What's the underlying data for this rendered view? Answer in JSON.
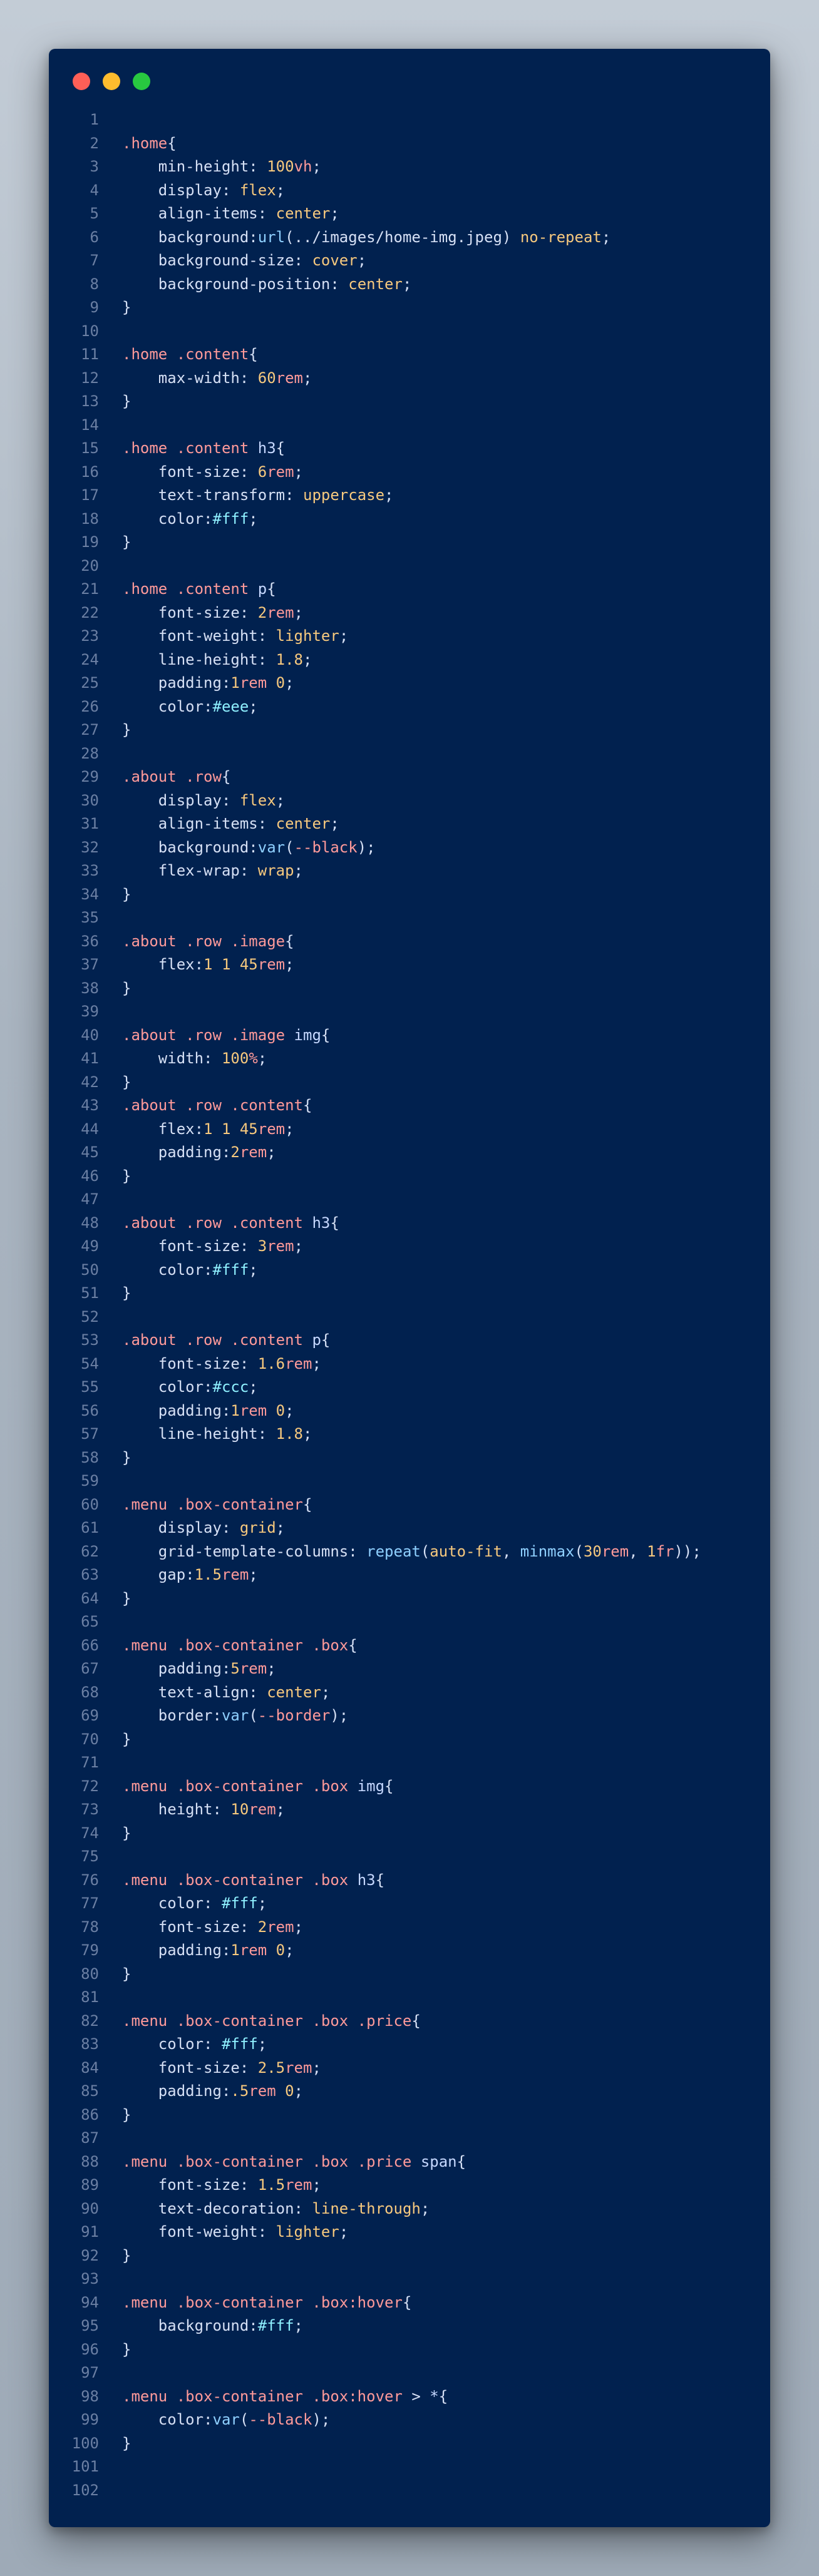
{
  "window": {
    "traffic_lights": [
      {
        "name": "close",
        "color": "#fe5f57"
      },
      {
        "name": "minimize",
        "color": "#febc2e"
      },
      {
        "name": "maximize",
        "color": "#28c840"
      }
    ]
  },
  "colors": {
    "selector": "#ff9a9a",
    "tag": "#c6d8ff",
    "property": "#d6e0f5",
    "value": "#f7c97e",
    "unit": "#ff9a9a",
    "function": "#8fd0ff",
    "hex": "#8ff0ff",
    "line_number": "#6b7fa3"
  },
  "lines": [
    [],
    [
      [
        "sel",
        ".home"
      ],
      [
        "punc",
        "{"
      ]
    ],
    [
      [
        "ind",
        "    "
      ],
      [
        "prop",
        "min-height"
      ],
      [
        "punc",
        ": "
      ],
      [
        "num",
        "100"
      ],
      [
        "unit",
        "vh"
      ],
      [
        "punc",
        ";"
      ]
    ],
    [
      [
        "ind",
        "    "
      ],
      [
        "prop",
        "display"
      ],
      [
        "punc",
        ": "
      ],
      [
        "val",
        "flex"
      ],
      [
        "punc",
        ";"
      ]
    ],
    [
      [
        "ind",
        "    "
      ],
      [
        "prop",
        "align-items"
      ],
      [
        "punc",
        ": "
      ],
      [
        "val",
        "center"
      ],
      [
        "punc",
        ";"
      ]
    ],
    [
      [
        "ind",
        "    "
      ],
      [
        "prop",
        "background"
      ],
      [
        "punc",
        ":"
      ],
      [
        "func",
        "url"
      ],
      [
        "punc",
        "("
      ],
      [
        "str",
        "../images/home-img.jpeg"
      ],
      [
        "punc",
        ") "
      ],
      [
        "val",
        "no-repeat"
      ],
      [
        "punc",
        ";"
      ]
    ],
    [
      [
        "ind",
        "    "
      ],
      [
        "prop",
        "background-size"
      ],
      [
        "punc",
        ": "
      ],
      [
        "val",
        "cover"
      ],
      [
        "punc",
        ";"
      ]
    ],
    [
      [
        "ind",
        "    "
      ],
      [
        "prop",
        "background-position"
      ],
      [
        "punc",
        ": "
      ],
      [
        "val",
        "center"
      ],
      [
        "punc",
        ";"
      ]
    ],
    [
      [
        "punc",
        "}"
      ]
    ],
    [],
    [
      [
        "sel",
        ".home .content"
      ],
      [
        "punc",
        "{"
      ]
    ],
    [
      [
        "ind",
        "    "
      ],
      [
        "prop",
        "max-width"
      ],
      [
        "punc",
        ": "
      ],
      [
        "num",
        "60"
      ],
      [
        "unit",
        "rem"
      ],
      [
        "punc",
        ";"
      ]
    ],
    [
      [
        "punc",
        "}"
      ]
    ],
    [],
    [
      [
        "sel",
        ".home .content "
      ],
      [
        "tag",
        "h3"
      ],
      [
        "punc",
        "{"
      ]
    ],
    [
      [
        "ind",
        "    "
      ],
      [
        "prop",
        "font-size"
      ],
      [
        "punc",
        ": "
      ],
      [
        "num",
        "6"
      ],
      [
        "unit",
        "rem"
      ],
      [
        "punc",
        ";"
      ]
    ],
    [
      [
        "ind",
        "    "
      ],
      [
        "prop",
        "text-transform"
      ],
      [
        "punc",
        ": "
      ],
      [
        "val",
        "uppercase"
      ],
      [
        "punc",
        ";"
      ]
    ],
    [
      [
        "ind",
        "    "
      ],
      [
        "prop",
        "color"
      ],
      [
        "punc",
        ":"
      ],
      [
        "hex",
        "#fff"
      ],
      [
        "punc",
        ";"
      ]
    ],
    [
      [
        "punc",
        "}"
      ]
    ],
    [],
    [
      [
        "sel",
        ".home .content "
      ],
      [
        "tag",
        "p"
      ],
      [
        "punc",
        "{"
      ]
    ],
    [
      [
        "ind",
        "    "
      ],
      [
        "prop",
        "font-size"
      ],
      [
        "punc",
        ": "
      ],
      [
        "num",
        "2"
      ],
      [
        "unit",
        "rem"
      ],
      [
        "punc",
        ";"
      ]
    ],
    [
      [
        "ind",
        "    "
      ],
      [
        "prop",
        "font-weight"
      ],
      [
        "punc",
        ": "
      ],
      [
        "val",
        "lighter"
      ],
      [
        "punc",
        ";"
      ]
    ],
    [
      [
        "ind",
        "    "
      ],
      [
        "prop",
        "line-height"
      ],
      [
        "punc",
        ": "
      ],
      [
        "num",
        "1.8"
      ],
      [
        "punc",
        ";"
      ]
    ],
    [
      [
        "ind",
        "    "
      ],
      [
        "prop",
        "padding"
      ],
      [
        "punc",
        ":"
      ],
      [
        "num",
        "1"
      ],
      [
        "unit",
        "rem"
      ],
      [
        "punc",
        " "
      ],
      [
        "num",
        "0"
      ],
      [
        "punc",
        ";"
      ]
    ],
    [
      [
        "ind",
        "    "
      ],
      [
        "prop",
        "color"
      ],
      [
        "punc",
        ":"
      ],
      [
        "hex",
        "#eee"
      ],
      [
        "punc",
        ";"
      ]
    ],
    [
      [
        "punc",
        "}"
      ]
    ],
    [],
    [
      [
        "sel",
        ".about .row"
      ],
      [
        "punc",
        "{"
      ]
    ],
    [
      [
        "ind",
        "    "
      ],
      [
        "prop",
        "display"
      ],
      [
        "punc",
        ": "
      ],
      [
        "val",
        "flex"
      ],
      [
        "punc",
        ";"
      ]
    ],
    [
      [
        "ind",
        "    "
      ],
      [
        "prop",
        "align-items"
      ],
      [
        "punc",
        ": "
      ],
      [
        "val",
        "center"
      ],
      [
        "punc",
        ";"
      ]
    ],
    [
      [
        "ind",
        "    "
      ],
      [
        "prop",
        "background"
      ],
      [
        "punc",
        ":"
      ],
      [
        "func",
        "var"
      ],
      [
        "punc",
        "("
      ],
      [
        "var",
        "--black"
      ],
      [
        "punc",
        ");"
      ]
    ],
    [
      [
        "ind",
        "    "
      ],
      [
        "prop",
        "flex-wrap"
      ],
      [
        "punc",
        ": "
      ],
      [
        "val",
        "wrap"
      ],
      [
        "punc",
        ";"
      ]
    ],
    [
      [
        "punc",
        "}"
      ]
    ],
    [],
    [
      [
        "sel",
        ".about .row .image"
      ],
      [
        "punc",
        "{"
      ]
    ],
    [
      [
        "ind",
        "    "
      ],
      [
        "prop",
        "flex"
      ],
      [
        "punc",
        ":"
      ],
      [
        "num",
        "1"
      ],
      [
        "punc",
        " "
      ],
      [
        "num",
        "1"
      ],
      [
        "punc",
        " "
      ],
      [
        "num",
        "45"
      ],
      [
        "unit",
        "rem"
      ],
      [
        "punc",
        ";"
      ]
    ],
    [
      [
        "punc",
        "}"
      ]
    ],
    [],
    [
      [
        "sel",
        ".about .row .image "
      ],
      [
        "tag",
        "img"
      ],
      [
        "punc",
        "{"
      ]
    ],
    [
      [
        "ind",
        "    "
      ],
      [
        "prop",
        "width"
      ],
      [
        "punc",
        ": "
      ],
      [
        "num",
        "100"
      ],
      [
        "unit",
        "%"
      ],
      [
        "punc",
        ";"
      ]
    ],
    [
      [
        "punc",
        "}"
      ]
    ],
    [
      [
        "sel",
        ".about .row .content"
      ],
      [
        "punc",
        "{"
      ]
    ],
    [
      [
        "ind",
        "    "
      ],
      [
        "prop",
        "flex"
      ],
      [
        "punc",
        ":"
      ],
      [
        "num",
        "1"
      ],
      [
        "punc",
        " "
      ],
      [
        "num",
        "1"
      ],
      [
        "punc",
        " "
      ],
      [
        "num",
        "45"
      ],
      [
        "unit",
        "rem"
      ],
      [
        "punc",
        ";"
      ]
    ],
    [
      [
        "ind",
        "    "
      ],
      [
        "prop",
        "padding"
      ],
      [
        "punc",
        ":"
      ],
      [
        "num",
        "2"
      ],
      [
        "unit",
        "rem"
      ],
      [
        "punc",
        ";"
      ]
    ],
    [
      [
        "punc",
        "}"
      ]
    ],
    [],
    [
      [
        "sel",
        ".about .row .content "
      ],
      [
        "tag",
        "h3"
      ],
      [
        "punc",
        "{"
      ]
    ],
    [
      [
        "ind",
        "    "
      ],
      [
        "prop",
        "font-size"
      ],
      [
        "punc",
        ": "
      ],
      [
        "num",
        "3"
      ],
      [
        "unit",
        "rem"
      ],
      [
        "punc",
        ";"
      ]
    ],
    [
      [
        "ind",
        "    "
      ],
      [
        "prop",
        "color"
      ],
      [
        "punc",
        ":"
      ],
      [
        "hex",
        "#fff"
      ],
      [
        "punc",
        ";"
      ]
    ],
    [
      [
        "punc",
        "}"
      ]
    ],
    [],
    [
      [
        "sel",
        ".about .row .content "
      ],
      [
        "tag",
        "p"
      ],
      [
        "punc",
        "{"
      ]
    ],
    [
      [
        "ind",
        "    "
      ],
      [
        "prop",
        "font-size"
      ],
      [
        "punc",
        ": "
      ],
      [
        "num",
        "1.6"
      ],
      [
        "unit",
        "rem"
      ],
      [
        "punc",
        ";"
      ]
    ],
    [
      [
        "ind",
        "    "
      ],
      [
        "prop",
        "color"
      ],
      [
        "punc",
        ":"
      ],
      [
        "hex",
        "#ccc"
      ],
      [
        "punc",
        ";"
      ]
    ],
    [
      [
        "ind",
        "    "
      ],
      [
        "prop",
        "padding"
      ],
      [
        "punc",
        ":"
      ],
      [
        "num",
        "1"
      ],
      [
        "unit",
        "rem"
      ],
      [
        "punc",
        " "
      ],
      [
        "num",
        "0"
      ],
      [
        "punc",
        ";"
      ]
    ],
    [
      [
        "ind",
        "    "
      ],
      [
        "prop",
        "line-height"
      ],
      [
        "punc",
        ": "
      ],
      [
        "num",
        "1.8"
      ],
      [
        "punc",
        ";"
      ]
    ],
    [
      [
        "punc",
        "}"
      ]
    ],
    [],
    [
      [
        "sel",
        ".menu .box-container"
      ],
      [
        "punc",
        "{"
      ]
    ],
    [
      [
        "ind",
        "    "
      ],
      [
        "prop",
        "display"
      ],
      [
        "punc",
        ": "
      ],
      [
        "val",
        "grid"
      ],
      [
        "punc",
        ";"
      ]
    ],
    [
      [
        "ind",
        "    "
      ],
      [
        "prop",
        "grid-template-columns"
      ],
      [
        "punc",
        ": "
      ],
      [
        "func",
        "repeat"
      ],
      [
        "punc",
        "("
      ],
      [
        "val",
        "auto-fit"
      ],
      [
        "punc",
        ", "
      ],
      [
        "func",
        "minmax"
      ],
      [
        "punc",
        "("
      ],
      [
        "num",
        "30"
      ],
      [
        "unit",
        "rem"
      ],
      [
        "punc",
        ", "
      ],
      [
        "num",
        "1"
      ],
      [
        "unit",
        "fr"
      ],
      [
        "punc",
        "));"
      ]
    ],
    [
      [
        "ind",
        "    "
      ],
      [
        "prop",
        "gap"
      ],
      [
        "punc",
        ":"
      ],
      [
        "num",
        "1.5"
      ],
      [
        "unit",
        "rem"
      ],
      [
        "punc",
        ";"
      ]
    ],
    [
      [
        "punc",
        "}"
      ]
    ],
    [],
    [
      [
        "sel",
        ".menu .box-container .box"
      ],
      [
        "punc",
        "{"
      ]
    ],
    [
      [
        "ind",
        "    "
      ],
      [
        "prop",
        "padding"
      ],
      [
        "punc",
        ":"
      ],
      [
        "num",
        "5"
      ],
      [
        "unit",
        "rem"
      ],
      [
        "punc",
        ";"
      ]
    ],
    [
      [
        "ind",
        "    "
      ],
      [
        "prop",
        "text-align"
      ],
      [
        "punc",
        ": "
      ],
      [
        "val",
        "center"
      ],
      [
        "punc",
        ";"
      ]
    ],
    [
      [
        "ind",
        "    "
      ],
      [
        "prop",
        "border"
      ],
      [
        "punc",
        ":"
      ],
      [
        "func",
        "var"
      ],
      [
        "punc",
        "("
      ],
      [
        "var",
        "--border"
      ],
      [
        "punc",
        ");"
      ]
    ],
    [
      [
        "punc",
        "}"
      ]
    ],
    [],
    [
      [
        "sel",
        ".menu .box-container .box "
      ],
      [
        "tag",
        "img"
      ],
      [
        "punc",
        "{"
      ]
    ],
    [
      [
        "ind",
        "    "
      ],
      [
        "prop",
        "height"
      ],
      [
        "punc",
        ": "
      ],
      [
        "num",
        "10"
      ],
      [
        "unit",
        "rem"
      ],
      [
        "punc",
        ";"
      ]
    ],
    [
      [
        "punc",
        "}"
      ]
    ],
    [],
    [
      [
        "sel",
        ".menu .box-container .box "
      ],
      [
        "tag",
        "h3"
      ],
      [
        "punc",
        "{"
      ]
    ],
    [
      [
        "ind",
        "    "
      ],
      [
        "prop",
        "color"
      ],
      [
        "punc",
        ": "
      ],
      [
        "hex",
        "#fff"
      ],
      [
        "punc",
        ";"
      ]
    ],
    [
      [
        "ind",
        "    "
      ],
      [
        "prop",
        "font-size"
      ],
      [
        "punc",
        ": "
      ],
      [
        "num",
        "2"
      ],
      [
        "unit",
        "rem"
      ],
      [
        "punc",
        ";"
      ]
    ],
    [
      [
        "ind",
        "    "
      ],
      [
        "prop",
        "padding"
      ],
      [
        "punc",
        ":"
      ],
      [
        "num",
        "1"
      ],
      [
        "unit",
        "rem"
      ],
      [
        "punc",
        " "
      ],
      [
        "num",
        "0"
      ],
      [
        "punc",
        ";"
      ]
    ],
    [
      [
        "punc",
        "}"
      ]
    ],
    [],
    [
      [
        "sel",
        ".menu .box-container .box .price"
      ],
      [
        "punc",
        "{"
      ]
    ],
    [
      [
        "ind",
        "    "
      ],
      [
        "prop",
        "color"
      ],
      [
        "punc",
        ": "
      ],
      [
        "hex",
        "#fff"
      ],
      [
        "punc",
        ";"
      ]
    ],
    [
      [
        "ind",
        "    "
      ],
      [
        "prop",
        "font-size"
      ],
      [
        "punc",
        ": "
      ],
      [
        "num",
        "2.5"
      ],
      [
        "unit",
        "rem"
      ],
      [
        "punc",
        ";"
      ]
    ],
    [
      [
        "ind",
        "    "
      ],
      [
        "prop",
        "padding"
      ],
      [
        "punc",
        ":"
      ],
      [
        "num",
        ".5"
      ],
      [
        "unit",
        "rem"
      ],
      [
        "punc",
        " "
      ],
      [
        "num",
        "0"
      ],
      [
        "punc",
        ";"
      ]
    ],
    [
      [
        "punc",
        "}"
      ]
    ],
    [],
    [
      [
        "sel",
        ".menu .box-container .box .price "
      ],
      [
        "tag",
        "span"
      ],
      [
        "punc",
        "{"
      ]
    ],
    [
      [
        "ind",
        "    "
      ],
      [
        "prop",
        "font-size"
      ],
      [
        "punc",
        ": "
      ],
      [
        "num",
        "1.5"
      ],
      [
        "unit",
        "rem"
      ],
      [
        "punc",
        ";"
      ]
    ],
    [
      [
        "ind",
        "    "
      ],
      [
        "prop",
        "text-decoration"
      ],
      [
        "punc",
        ": "
      ],
      [
        "val",
        "line-through"
      ],
      [
        "punc",
        ";"
      ]
    ],
    [
      [
        "ind",
        "    "
      ],
      [
        "prop",
        "font-weight"
      ],
      [
        "punc",
        ": "
      ],
      [
        "val",
        "lighter"
      ],
      [
        "punc",
        ";"
      ]
    ],
    [
      [
        "punc",
        "}"
      ]
    ],
    [],
    [
      [
        "sel",
        ".menu .box-container .box:hover"
      ],
      [
        "punc",
        "{"
      ]
    ],
    [
      [
        "ind",
        "    "
      ],
      [
        "prop",
        "background"
      ],
      [
        "punc",
        ":"
      ],
      [
        "hex",
        "#fff"
      ],
      [
        "punc",
        ";"
      ]
    ],
    [
      [
        "punc",
        "}"
      ]
    ],
    [],
    [
      [
        "sel",
        ".menu .box-container .box:hover "
      ],
      [
        "punc",
        "> "
      ],
      [
        "tag",
        "*"
      ],
      [
        "punc",
        "{"
      ]
    ],
    [
      [
        "ind",
        "    "
      ],
      [
        "prop",
        "color"
      ],
      [
        "punc",
        ":"
      ],
      [
        "func",
        "var"
      ],
      [
        "punc",
        "("
      ],
      [
        "var",
        "--black"
      ],
      [
        "punc",
        ");"
      ]
    ],
    [
      [
        "punc",
        "}"
      ]
    ],
    [],
    []
  ]
}
